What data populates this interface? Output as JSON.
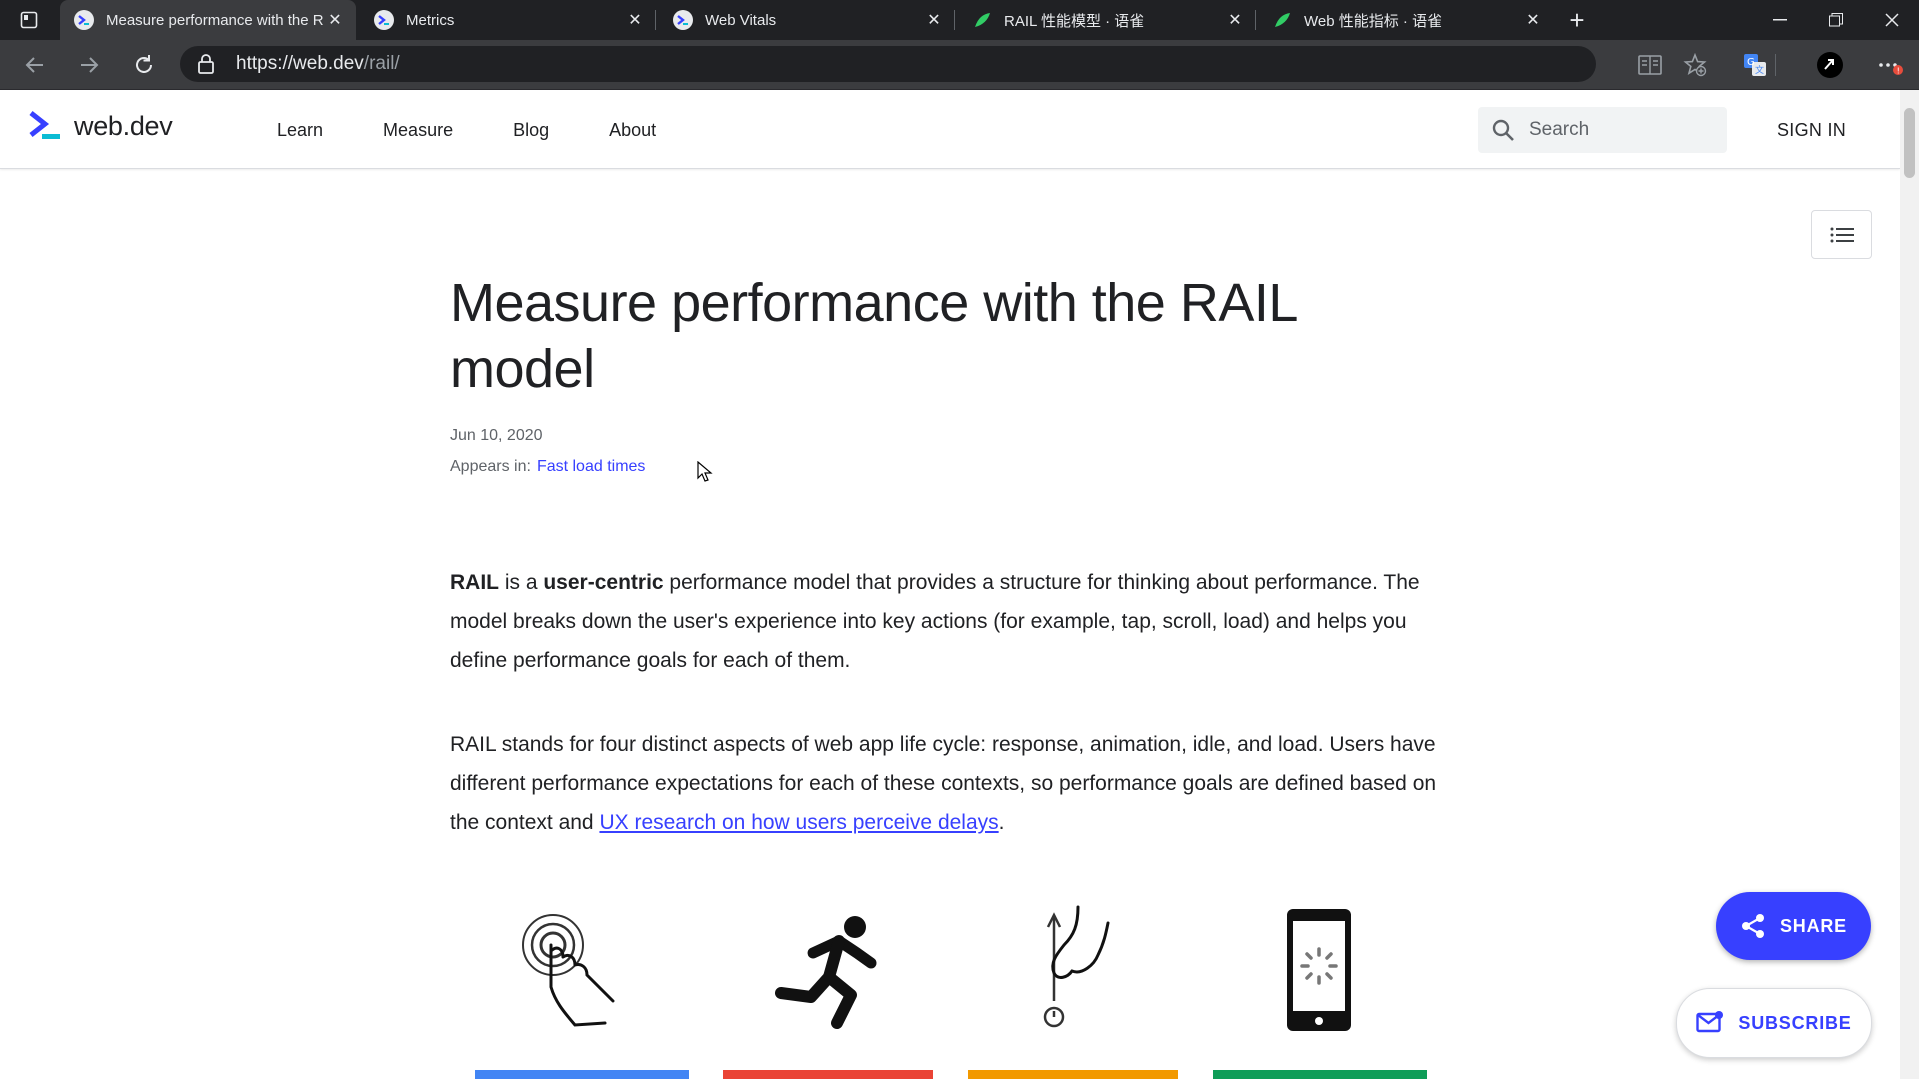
{
  "browser": {
    "tabs": [
      {
        "title": "Measure performance with the R",
        "favicon": "webdev-icon",
        "active": true
      },
      {
        "title": "Metrics",
        "favicon": "webdev-icon",
        "active": false
      },
      {
        "title": "Web Vitals",
        "favicon": "webdev-icon",
        "active": false
      },
      {
        "title": "RAIL 性能模型 · 语雀",
        "favicon": "yuque-icon",
        "active": false
      },
      {
        "title": "Web 性能指标 · 语雀",
        "favicon": "yuque-icon",
        "active": false
      }
    ],
    "url_host": "https://web.dev",
    "url_path": "/rail/"
  },
  "site": {
    "logo_text": "web.dev",
    "nav": [
      "Learn",
      "Measure",
      "Blog",
      "About"
    ],
    "search_placeholder": "Search",
    "sign_in": "SIGN IN"
  },
  "article": {
    "title": "Measure performance with the RAIL model",
    "date": "Jun 10, 2020",
    "appears_label": "Appears in:",
    "appears_link": "Fast load times",
    "p1": {
      "strong1": "RAIL",
      "t1": " is a ",
      "strong2": "user-centric",
      "t2": " performance model that provides a structure for thinking about performance. The model breaks down the user's experience into key actions (for example, tap, scroll, load) and helps you define performance goals for each of them."
    },
    "p2": {
      "t1": "RAIL stands for four distinct aspects of web app life cycle: response, animation, idle, and load. Users have different performance expectations for each of these contexts, so performance goals are defined based on the context and ",
      "link": "UX research on how users perceive delays",
      "t2": "."
    },
    "illustrations": [
      {
        "icon": "tap-response-icon",
        "color": "#4285f4"
      },
      {
        "icon": "running-animation-icon",
        "color": "#ea4335"
      },
      {
        "icon": "idle-hand-icon",
        "color": "#f29900"
      },
      {
        "icon": "phone-load-icon",
        "color": "#0f9d58"
      }
    ]
  },
  "fab": {
    "share": "SHARE",
    "subscribe": "SUBSCRIBE"
  },
  "colors": {
    "accent": "#3740ff",
    "chrome_dark": "#202124",
    "chrome_mid": "#3b3c3f"
  }
}
